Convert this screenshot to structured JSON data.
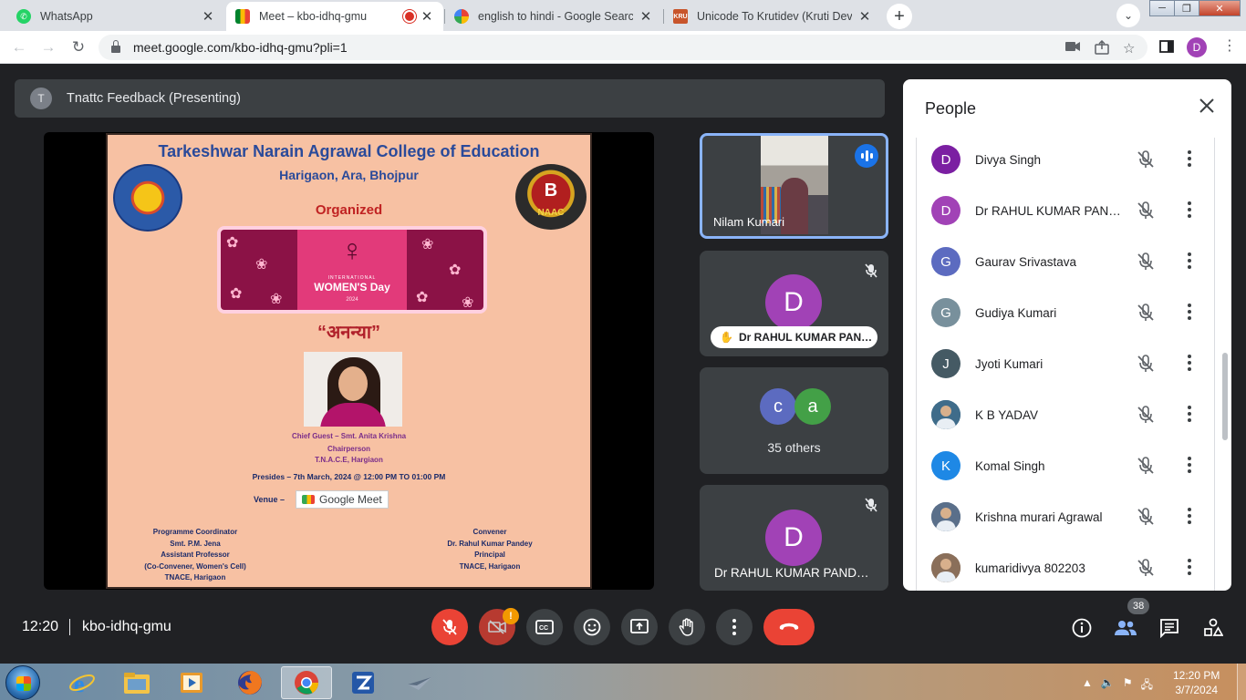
{
  "browser": {
    "tabs": [
      {
        "title": "WhatsApp",
        "favicon": "whatsapp-icon",
        "color": "#25d366"
      },
      {
        "title": "Meet – kbo-idhq-gmu",
        "favicon": "meet-icon",
        "color": "#00832d",
        "active": true
      },
      {
        "title": "english to hindi - Google Search",
        "favicon": "google-icon",
        "color": "#4285f4"
      },
      {
        "title": "Unicode To Krutidev (Kruti Dev) C",
        "favicon": "kru-icon",
        "color": "#c8552b"
      }
    ],
    "url": "meet.google.com/kbo-idhq-gmu?pli=1",
    "profile_initial": "D"
  },
  "meet": {
    "presenter_initial": "T",
    "presenter_label": "Tnattc Feedback (Presenting)",
    "poster": {
      "title": "Tarkeshwar Narain Agrawal College of Education",
      "subtitle": "Harigaon, Ara, Bhojpur",
      "naac_grade": "B",
      "naac_label": "NAAC",
      "organized": "Organized",
      "banner_small": "INTERNATIONAL",
      "banner_main": "WOMEN'S Day",
      "banner_year": "2024",
      "hindi_title": "“अनन्या”",
      "chief_guest": "Chief Guest – Smt. Anita Krishna",
      "chief_role": "Chairperson",
      "chief_org": "T.N.A.C.E, Hargiaon",
      "presides": "Presides – 7th March, 2024 @ 12:00 PM TO 01:00 PM",
      "venue_label": "Venue –",
      "venue_app": "Google Meet",
      "coordinator": [
        "Programme Coordinator",
        "Smt. P.M. Jena",
        "Assistant Professor",
        "(Co-Convener, Women's Cell)",
        "TNACE, Harigaon"
      ],
      "convener": [
        "Convener",
        "Dr. Rahul Kumar Pandey",
        "Principal",
        "TNACE, Harigaon"
      ]
    },
    "tiles": {
      "speaker_name": "Nilam Kumari",
      "tile2_initial": "D",
      "tile2_name": "Dr RAHUL KUMAR PAN…",
      "others_a": "c",
      "others_b": "a",
      "others_label": "35 others",
      "tile4_initial": "D",
      "tile4_name": "Dr RAHUL KUMAR PAND…"
    },
    "people_panel": {
      "title": "People",
      "participants": [
        {
          "initial": "D",
          "name": "Divya Singh",
          "color": "#7b1fa2"
        },
        {
          "initial": "D",
          "name": "Dr RAHUL KUMAR PAND...",
          "color": "#a142b6"
        },
        {
          "initial": "G",
          "name": "Gaurav Srivastava",
          "color": "#5c6bc0"
        },
        {
          "initial": "G",
          "name": "Gudiya Kumari",
          "color": "#78909c"
        },
        {
          "initial": "J",
          "name": "Jyoti Kumari",
          "color": "#455a64"
        },
        {
          "initial": "",
          "name": "K B YADAV",
          "color": "#3f6c8a",
          "photo": true
        },
        {
          "initial": "K",
          "name": "Komal Singh",
          "color": "#1e88e5"
        },
        {
          "initial": "",
          "name": "Krishna murari Agrawal",
          "color": "#5a6f8a",
          "photo": true
        },
        {
          "initial": "",
          "name": "kumaridivya 802203",
          "color": "#8a6f5a",
          "photo": true
        }
      ]
    },
    "bottom_bar": {
      "time": "12:20",
      "meeting_code": "kbo-idhq-gmu",
      "camera_warning": "!",
      "participant_count": "38"
    }
  },
  "taskbar": {
    "time": "12:20 PM",
    "date": "3/7/2024"
  }
}
